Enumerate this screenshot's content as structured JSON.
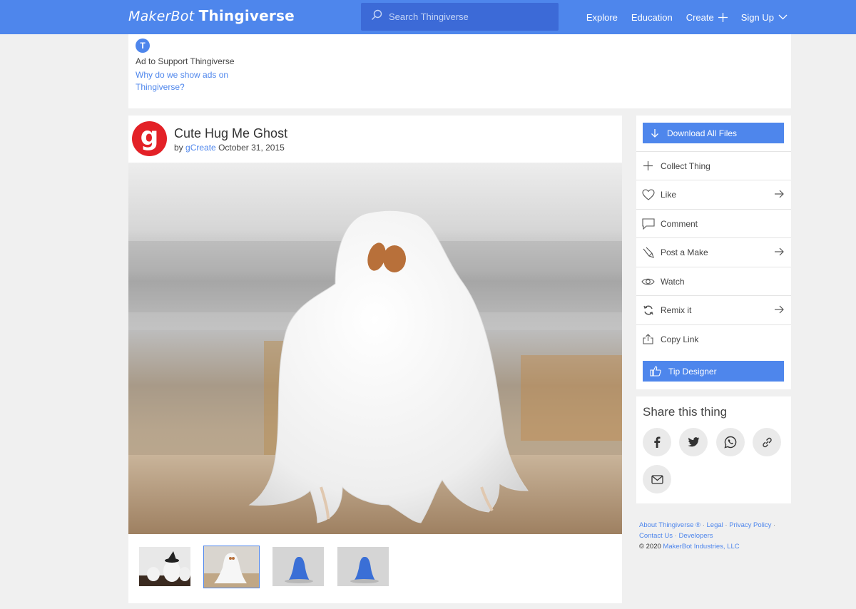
{
  "header": {
    "brand_left": "MakerBot",
    "brand_right": "Thingiverse",
    "search_placeholder": "Search Thingiverse",
    "nav": {
      "explore": "Explore",
      "education": "Education",
      "create": "Create",
      "signup": "Sign Up"
    }
  },
  "ad": {
    "logo_letter": "T",
    "label": "Ad to Support Thingiverse",
    "link": "Why do we show ads on Thingiverse?"
  },
  "thing": {
    "avatar_letter": "g",
    "title": "Cute Hug Me Ghost",
    "by": "by",
    "author": "gCreate",
    "date": "October 31, 2015",
    "thumbnails": [
      {
        "name": "ghosts-with-witch-hat",
        "selected": false
      },
      {
        "name": "white-ghost",
        "selected": true
      },
      {
        "name": "blue-ghost-render-1",
        "selected": false
      },
      {
        "name": "blue-ghost-render-2",
        "selected": false
      }
    ]
  },
  "actions": {
    "download": "Download All Files",
    "collect": "Collect Thing",
    "like": "Like",
    "comment": "Comment",
    "post_make": "Post a Make",
    "watch": "Watch",
    "remix": "Remix it",
    "copy_link": "Copy Link",
    "tip": "Tip Designer"
  },
  "share": {
    "title": "Share this thing",
    "buttons": [
      "facebook-icon",
      "twitter-icon",
      "whatsapp-icon",
      "link-icon",
      "mail-icon"
    ]
  },
  "footer": {
    "about": "About Thingiverse ®",
    "legal": "Legal",
    "privacy": "Privacy Policy",
    "contact": "Contact Us",
    "developers": "Developers",
    "copyright": "©  2020",
    "company": "MakerBot Industries, LLC",
    "separator": "·"
  },
  "colors": {
    "accent": "#4e86ec",
    "search_bg": "#3c6ad7",
    "avatar_red": "#e32127",
    "page_bg": "#f0f0f0"
  }
}
